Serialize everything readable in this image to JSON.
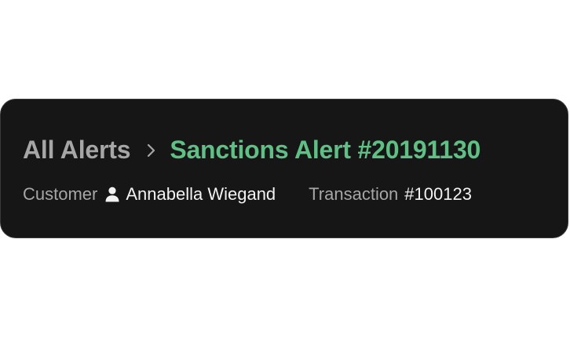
{
  "breadcrumb": {
    "parent_label": "All Alerts",
    "current_label": "Sanctions Alert #20191130"
  },
  "meta": {
    "customer_label": "Customer",
    "customer_value": "Annabella Wiegand",
    "transaction_label": "Transaction",
    "transaction_value": "#100123"
  },
  "icons": {
    "separator": "chevron-right-icon",
    "customer": "user-icon"
  },
  "colors": {
    "background": "#161616",
    "muted_text": "#a6a6a6",
    "accent": "#5fbf85",
    "primary_text": "#f2f2f2"
  }
}
